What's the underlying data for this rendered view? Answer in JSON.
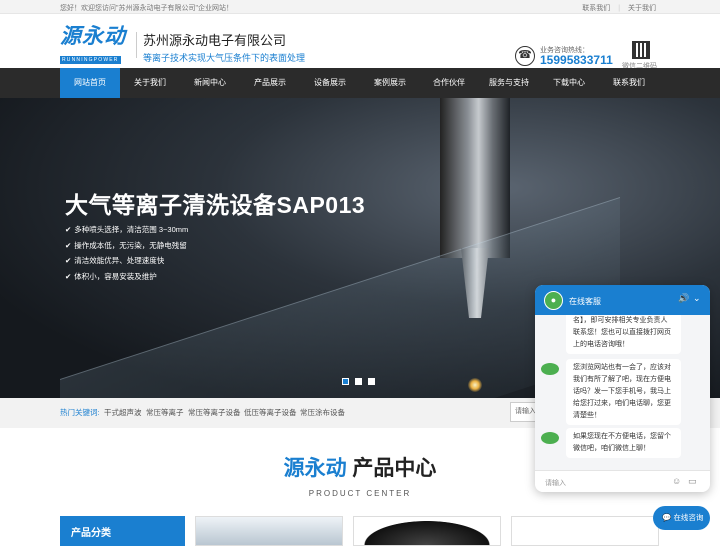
{
  "topbar": {
    "welcome": "您好！欢迎您访问\"苏州源永动电子有限公司\"企业网站！",
    "link_contact": "联系我们",
    "link_about": "关于我们"
  },
  "header": {
    "logo_text": "源永动",
    "logo_sub": "RUNNINGPOWER",
    "company_name": "苏州源永动电子有限公司",
    "slogan": "等离子技术实现大气压条件下的表面处理",
    "hotline_label": "业务咨询热线：",
    "hotline_number": "15995833711",
    "qr_label": "微信二维码"
  },
  "nav": {
    "items": [
      {
        "label": "网站首页",
        "active": true
      },
      {
        "label": "关于我们"
      },
      {
        "label": "新闻中心"
      },
      {
        "label": "产品展示"
      },
      {
        "label": "设备展示"
      },
      {
        "label": "案例展示"
      },
      {
        "label": "合作伙伴"
      },
      {
        "label": "服务与支持"
      },
      {
        "label": "下载中心"
      },
      {
        "label": "联系我们"
      }
    ]
  },
  "banner": {
    "title": "大气等离子清洗设备SAP013",
    "features": [
      "多种喷头选择，清洁范围 3~30mm",
      "操作成本低，无污染，无静电残留",
      "清洁效能优异、处理速度快",
      "体积小，容易安装及维护"
    ],
    "check_glyph": "✔"
  },
  "keywords": {
    "label": "热门关键词:",
    "items": [
      "干式超声波",
      "常压等离子",
      "常压等离子设备",
      "低压等离子设备",
      "常压涂布设备"
    ]
  },
  "search": {
    "placeholder": "请输入"
  },
  "products": {
    "title_brand": "源永动",
    "title_rest": " 产品中心",
    "subtitle": "PRODUCT CENTER",
    "category_label": "产品分类"
  },
  "chat": {
    "title": "在线客服",
    "messages": [
      "名】，即可安排相关专业负责人联系您！您也可以直接拨打网页上的电话咨询哦！",
      "您浏览网站也有一会了，应该对我们有所了解了吧，现在方便电话吗？发一下您手机号，我马上给您打过来，咱们电话聊，您更清楚些！",
      "如果您现在不方便电话，您留个微信吧，咱们微信上聊！"
    ],
    "input_placeholder": "请输入",
    "consult_button": "在线咨询"
  },
  "colors": {
    "accent": "#1a7fd0",
    "nav_bg": "#2b2b2b"
  }
}
